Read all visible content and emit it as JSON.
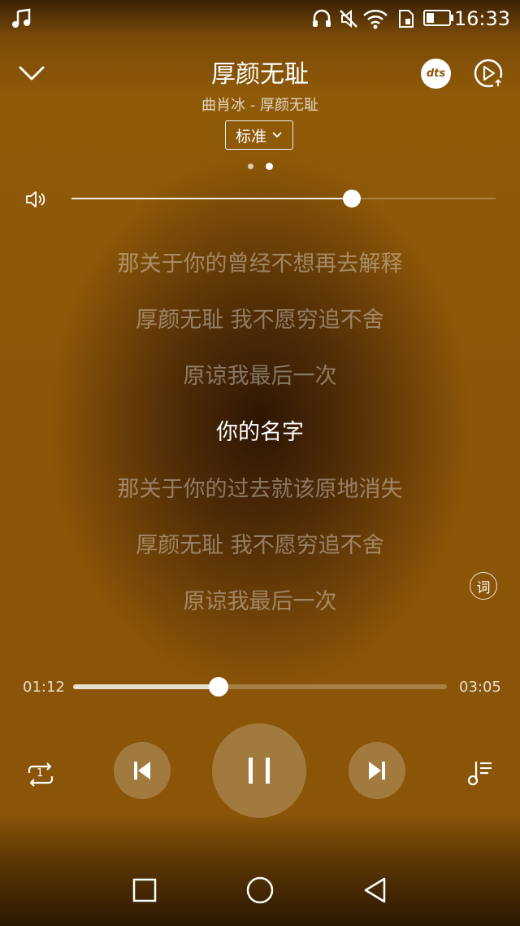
{
  "status_bar": {
    "time": "16:33",
    "icons": [
      "music-note-icon",
      "headphones-icon",
      "mute-icon",
      "wifi-icon",
      "sim-icon",
      "battery-icon"
    ]
  },
  "header": {
    "song_title": "厚颜无耻",
    "artist_album": "曲肖冰 - 厚颜无耻",
    "quality_label": "标准",
    "dts_label": "dts"
  },
  "page_indicator": {
    "pages": 2,
    "current": 2
  },
  "volume": {
    "level": 0.66
  },
  "lyrics": {
    "lines": [
      "那关于你的曾经不想再去解释",
      "厚颜无耻 我不愿穷追不舍",
      "原谅我最后一次",
      "你的名字",
      "那关于你的过去就该原地消失",
      "厚颜无耻 我不愿穷追不舍",
      "原谅我最后一次"
    ],
    "current_index": 3,
    "lyric_button_label": "词"
  },
  "progress": {
    "elapsed": "01:12",
    "total": "03:05",
    "fraction": 0.39
  },
  "controls": {
    "repeat_mode_label": "1",
    "icons": [
      "repeat-one-icon",
      "previous-icon",
      "pause-icon",
      "next-icon",
      "playlist-icon"
    ]
  },
  "nav_bar": {
    "icons": [
      "recent-apps-icon",
      "home-icon",
      "back-icon"
    ]
  },
  "colors": {
    "background": "#8b5508",
    "accent": "#ffffff"
  }
}
